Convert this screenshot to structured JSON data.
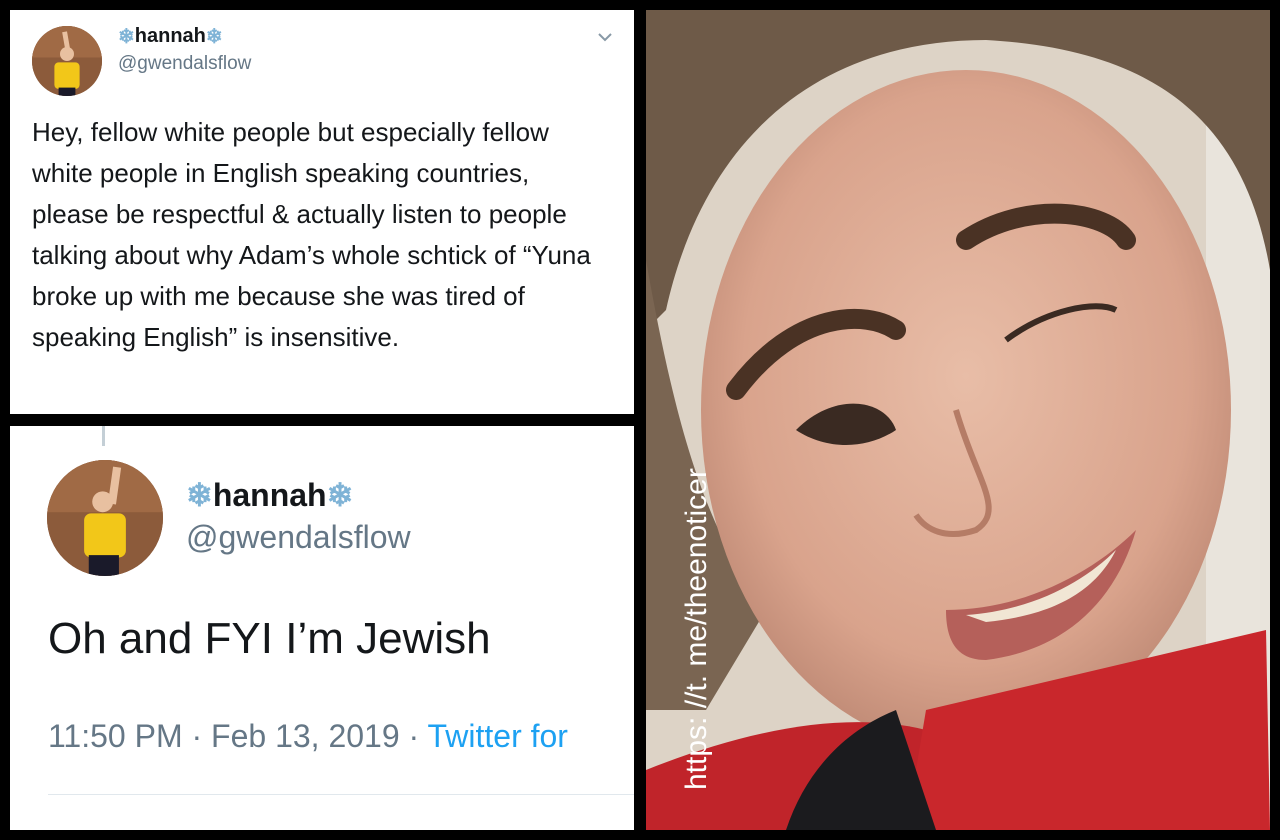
{
  "tweet1": {
    "display_name": "hannah",
    "handle": "@gwendalsflow",
    "text": "Hey, fellow white people but especially fellow white people in English speaking countries, please be respectful & actually listen to people talking about why Adam’s whole schtick of “Yuna broke up with me because she was tired of speaking English” is insensitive."
  },
  "tweet2": {
    "display_name": "hannah",
    "handle": "@gwendalsflow",
    "text": "Oh and FYI I’m Jewish",
    "time": "11:50 PM",
    "date": "Feb 13, 2019",
    "separator": "·",
    "source": "Twitter for"
  },
  "snowflake": "❄",
  "watermark": "https: //t. me/theenoticer",
  "colors": {
    "background": "#000000",
    "text": "#14171a",
    "secondary": "#657786",
    "link": "#1da1f2",
    "snowflake": "#7fb3d6"
  },
  "icons": [
    "snowflake-icon",
    "chevron-down-icon",
    "avatar"
  ]
}
